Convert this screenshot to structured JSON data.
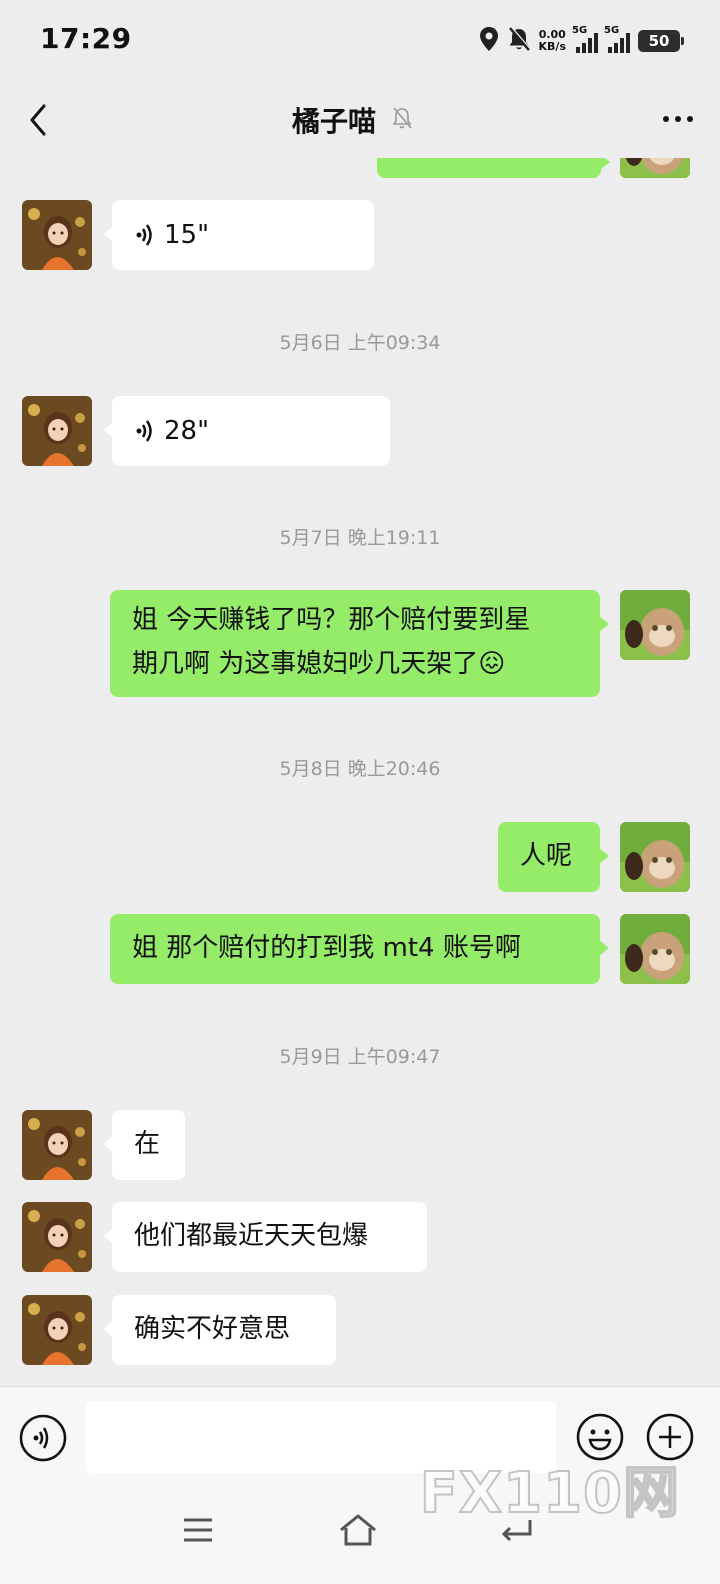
{
  "status_bar": {
    "time": "17:29",
    "net_speed_value": "0.00",
    "net_speed_unit": "KB/s",
    "signal_1_label": "5G",
    "signal_2_label": "5G",
    "battery": "50"
  },
  "nav": {
    "title": "橘子喵",
    "icons": {
      "back": "back-arrow-icon",
      "mute": "bell-off-icon",
      "more": "more-dots-icon"
    }
  },
  "chat": {
    "messages": [
      {
        "side": "in",
        "type": "voice",
        "duration": "15\""
      },
      {
        "type": "time",
        "text": "5月6日 上午09:34"
      },
      {
        "side": "in",
        "type": "voice",
        "duration": "28\""
      },
      {
        "type": "time",
        "text": "5月7日 晚上19:11"
      },
      {
        "side": "out",
        "type": "text",
        "line1": "姐 今天赚钱了吗？那个赔付要到星",
        "line2": "期几啊 为这事媳妇吵几天架了😖"
      },
      {
        "type": "time",
        "text": "5月8日 晚上20:46"
      },
      {
        "side": "out",
        "type": "text",
        "text": "人呢"
      },
      {
        "side": "out",
        "type": "text",
        "text": "姐 那个赔付的打到我 mt4 账号啊"
      },
      {
        "type": "time",
        "text": "5月9日 上午09:47"
      },
      {
        "side": "in",
        "type": "text",
        "text": "在"
      },
      {
        "side": "in",
        "type": "text",
        "text": "他们都最近天天包爆"
      },
      {
        "side": "in",
        "type": "text",
        "text": "确实不好意思"
      }
    ]
  },
  "input_bar": {
    "value": "",
    "icons": {
      "voice": "voice-mode-icon",
      "emoji": "emoji-icon",
      "plus": "plus-icon"
    }
  },
  "system_nav": {
    "icons": [
      "menu-icon",
      "home-icon",
      "back-icon"
    ]
  },
  "watermark": "FX110网",
  "colors": {
    "background": "#ededed",
    "outgoing_bubble": "#95ec69",
    "incoming_bubble": "#ffffff",
    "timestamp": "#999999"
  }
}
